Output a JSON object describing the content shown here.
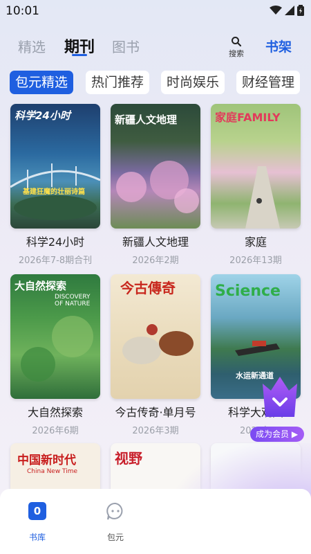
{
  "status_bar": {
    "time": "10:01"
  },
  "top_nav": {
    "tabs": [
      "精选",
      "期刊",
      "图书"
    ],
    "active_tab": "期刊",
    "search_label": "搜索",
    "shelf_label": "书架"
  },
  "chips": [
    "包元精选",
    "热门推荐",
    "时尚娱乐",
    "财经管理"
  ],
  "magazines": [
    {
      "title": "科学24小时",
      "issue": "2026年7-8期合刊",
      "cover_head": "科学24小时",
      "cover_sub": "基建狂魔的壮丽诗篇"
    },
    {
      "title": "新疆人文地理",
      "issue": "2026年2期",
      "cover_head": "新疆人文地理",
      "cover_sub": ""
    },
    {
      "title": "家庭",
      "issue": "2026年13期",
      "cover_head": "家庭FAMILY",
      "cover_sub": ""
    },
    {
      "title": "大自然探索",
      "issue": "2026年6期",
      "cover_head": "大自然探索",
      "cover_sub": "DISCOVERY OF NATURE"
    },
    {
      "title": "今古传奇·单月号",
      "issue": "2026年3期",
      "cover_head": "今古傳奇",
      "cover_sub": ""
    },
    {
      "title": "科学大观园",
      "issue": "2026年",
      "cover_head": "Science",
      "cover_sub": "水运新通道"
    },
    {
      "title": "",
      "issue": "",
      "cover_head": "中国新时代",
      "cover_sub": "China New Time"
    },
    {
      "title": "",
      "issue": "",
      "cover_head": "视野",
      "cover_sub": ""
    },
    {
      "title": "",
      "issue": "",
      "cover_head": "",
      "cover_sub": ""
    }
  ],
  "member_badge": {
    "label": "成为会员 ▶"
  },
  "bottom_nav": {
    "items": [
      {
        "label": "书库",
        "badge": "0"
      },
      {
        "label": "包元"
      }
    ]
  },
  "colors": {
    "accent": "#1f5fe0",
    "member": "#8a55f4"
  }
}
